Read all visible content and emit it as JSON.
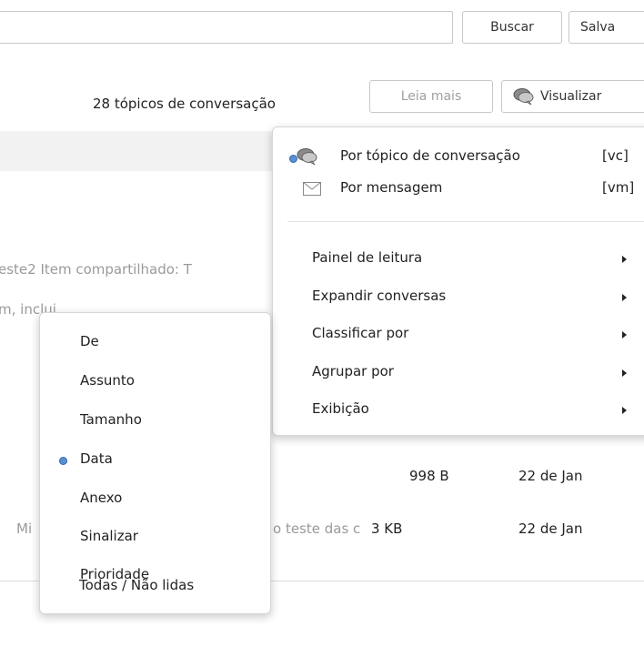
{
  "toolbar": {
    "search_label": "Buscar",
    "save_label": "Salva",
    "topic_count": "28 tópicos de conversação",
    "read_more_label": "Leia mais",
    "view_label": "Visualizar"
  },
  "list": {
    "row1_preview": "este2 Item compartilhado: T",
    "row2_preview": "m, inclui",
    "row3_size": "998 B",
    "row3_date": "22 de Jan",
    "row4_sender": "Mi",
    "row4_preview": "o teste das c",
    "row4_size": "3 KB",
    "row4_date": "22 de Jan"
  },
  "view_menu": {
    "by_topic": "Por tópico de conversação",
    "by_topic_key": "[vc]",
    "by_message": "Por mensagem",
    "by_message_key": "[vm]",
    "items": [
      "Painel de leitura",
      "Expandir conversas",
      "Classificar por",
      "Agrupar por",
      "Exibição"
    ]
  },
  "sort_menu": {
    "items": [
      "De",
      "Assunto",
      "Tamanho",
      "Data",
      "Anexo",
      "Sinalizar",
      "Prioridade",
      "Todas / Não lidas"
    ],
    "selected": "Data"
  },
  "colors": {
    "radio_dot": "#5b8fd0",
    "header_band": "#f2f2f2"
  }
}
